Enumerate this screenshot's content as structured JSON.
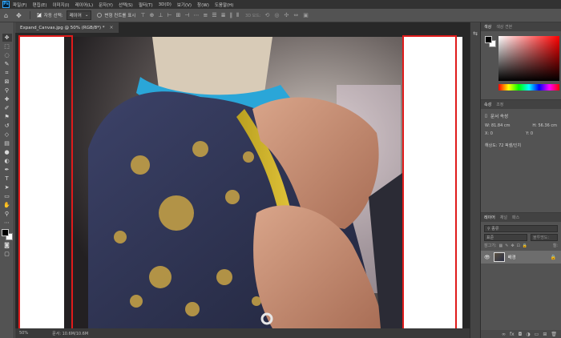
{
  "app": {
    "logo_label": "Ps"
  },
  "menu": [
    "파일(F)",
    "편집(E)",
    "이미지(I)",
    "레이어(L)",
    "문자(Y)",
    "선택(S)",
    "필터(T)",
    "3D(D)",
    "보기(V)",
    "창(W)",
    "도움말(H)"
  ],
  "options": {
    "auto_select_label": "자동 선택:",
    "auto_select_value": "레이어",
    "transform_controls_label": "변형 컨트롤 표시",
    "mode_3d_label": "3D 모드:"
  },
  "document": {
    "tab_title": "Expand_Canvas.jpg @ 50% (RGB/8*) *",
    "zoom": "50%",
    "doc_info": "문서: 10.6M/10.6M"
  },
  "color_panel": {
    "tabs": [
      "색상",
      "색상 견본"
    ]
  },
  "properties_panel": {
    "tabs": [
      "속성",
      "조정"
    ],
    "doc_label": "문서 속성",
    "width_label": "W:",
    "width_value": "81.84 cm",
    "height_label": "H:",
    "height_value": "56.36 cm",
    "x_label": "X:",
    "x_value": "0",
    "y_label": "Y:",
    "y_value": "0",
    "resolution": "해상도: 72 픽셀/인치"
  },
  "layers_panel": {
    "tabs": [
      "레이어",
      "채널",
      "패스"
    ],
    "filter_kind": "종류",
    "blend_mode": "표준",
    "opacity_label": "불투명도:",
    "lock_label": "잠그기:",
    "fill_label": "칠:",
    "layer_name": "배경"
  },
  "colors": {
    "foreground": "#000000",
    "background": "#ffffff",
    "highlight": "#e01b1b",
    "photoshop_blue": "#31a8ff"
  },
  "icons": {
    "tools": [
      "move-icon",
      "marquee-icon",
      "lasso-icon",
      "quick-select-icon",
      "crop-icon",
      "frame-icon",
      "eyedropper-icon",
      "healing-icon",
      "brush-icon",
      "stamp-icon",
      "history-brush-icon",
      "eraser-icon",
      "gradient-icon",
      "blur-icon",
      "dodge-icon",
      "pen-icon",
      "type-icon",
      "path-select-icon",
      "rectangle-icon",
      "hand-icon",
      "zoom-icon",
      "more-icon"
    ]
  }
}
